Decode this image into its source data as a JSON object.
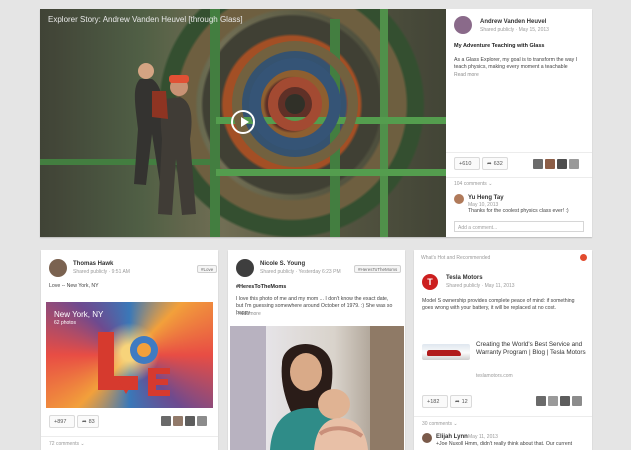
{
  "featured": {
    "media_title": "Explorer Story: Andrew Vanden Heuvel [through Glass]",
    "author": "Andrew Vanden Heuvel",
    "meta": "Shared publicly · May 15, 2013",
    "post_title": "My Adventure Teaching with Glass",
    "post_body": "As a Glass Explorer, my goal is to transform the way I teach physics, making every moment a teachable",
    "read_more": "Read more",
    "plus_count": "+610",
    "share_count": "632",
    "comments_label": "104 comments",
    "top_comment": {
      "author": "Yu Heng Tay",
      "time": "May 10, 2013",
      "text": "Thanks for the coolest physics class ever! :)"
    },
    "add_comment_placeholder": "Add a comment..."
  },
  "thomas": {
    "author": "Thomas Hawk",
    "meta": "Shared publicly · 9:51 AM",
    "tag": "#Love",
    "text": "Love -- New York, NY",
    "image_city": "New York, NY",
    "image_photos": "62 photos",
    "plus_count": "+897",
    "share_count": "83",
    "comments_label": "72 comments"
  },
  "nicole": {
    "author": "Nicole S. Young",
    "meta": "Shared publicly · Yesterday 6:23 PM",
    "tag": "#HeresToTheMoms",
    "hashtag": "#HeresToTheMoms",
    "text": "I love this photo of me and my mom ... I don't know the exact date, but I'm guessing somewhere around October of 1979. :) She was so happy",
    "read_more": "Read more"
  },
  "recommend": {
    "section_title": "What's Hot and Recommended",
    "author": "Tesla Motors",
    "meta": "Shared publicly · May 11, 2013",
    "text": "Model S ownership provides complete peace of mind: if something goes wrong with your battery, it will be replaced at no cost.",
    "link_title": "Creating the World's Best Service and Warranty Program | Blog | Tesla Motors",
    "link_domain": "teslamotors.com",
    "plus_count": "+182",
    "share_count": "12",
    "comments_label": "30 comments",
    "top_comment": {
      "author": "Elijah Lynn",
      "time": "May 11, 2013",
      "text": "+Joe Nuxoll Hmm, didn't really think about that. Our current"
    }
  }
}
